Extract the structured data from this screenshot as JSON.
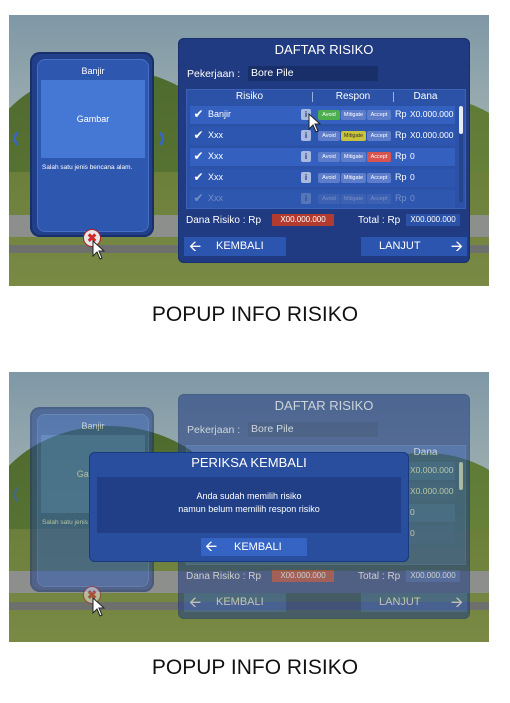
{
  "captions": [
    "POPUP INFO RISIKO",
    "POPUP INFO RISIKO"
  ],
  "card": {
    "title": "Banjir",
    "image_label": "Gambar",
    "description": "Salah satu jenis bencana alam."
  },
  "panel": {
    "title": "DAFTAR RISIKO",
    "job_label": "Pekerjaan :",
    "job_value": "Bore Pile",
    "columns": [
      "Risiko",
      "Respon",
      "Dana"
    ],
    "rows": [
      {
        "name": "Banjir",
        "avoid": "Avoid",
        "mitigate": "Mitigate",
        "accept": "Accept",
        "rp": "Rp",
        "amount": "X0.000.000"
      },
      {
        "name": "Xxx",
        "avoid": "Avoid",
        "mitigate": "Mitigate",
        "accept": "Accept",
        "rp": "Rp",
        "amount": "X0.000.000"
      },
      {
        "name": "Xxx",
        "avoid": "Avoid",
        "mitigate": "Mitigate",
        "accept": "Accept",
        "rp": "Rp",
        "amount": "0"
      },
      {
        "name": "Xxx",
        "avoid": "Avoid",
        "mitigate": "Mitigate",
        "accept": "Accept",
        "rp": "Rp",
        "amount": "0"
      },
      {
        "name": "Xxx",
        "avoid": "Avoid",
        "mitigate": "Mitigate",
        "accept": "Accept",
        "rp": "Rp",
        "amount": "0"
      }
    ],
    "info_glyph": "i",
    "dana_label": "Dana Risiko : Rp",
    "dana_value": "X00.000.000",
    "total_label": "Total : Rp",
    "total_value": "X00.000.000",
    "back_label": "KEMBALI",
    "next_label": "LANJUT"
  },
  "modal": {
    "title": "PERIKSA KEMBALI",
    "line1": "Anda sudah memilih risiko",
    "line2": "namun belum memilih respon risiko",
    "button_label": "KEMBALI"
  },
  "colors": {
    "panel_bg": "#203b81",
    "avoid_selected": "#4cae4c",
    "mitigate_selected": "#c9c23a",
    "accept_selected": "#d9534f",
    "pill_default": "#5d7cc9"
  },
  "icons": [
    "check-icon",
    "info-icon",
    "back-arrow-icon",
    "next-arrow-icon",
    "close-icon",
    "cursor-icon",
    "chevron-left-icon",
    "chevron-right-icon"
  ]
}
